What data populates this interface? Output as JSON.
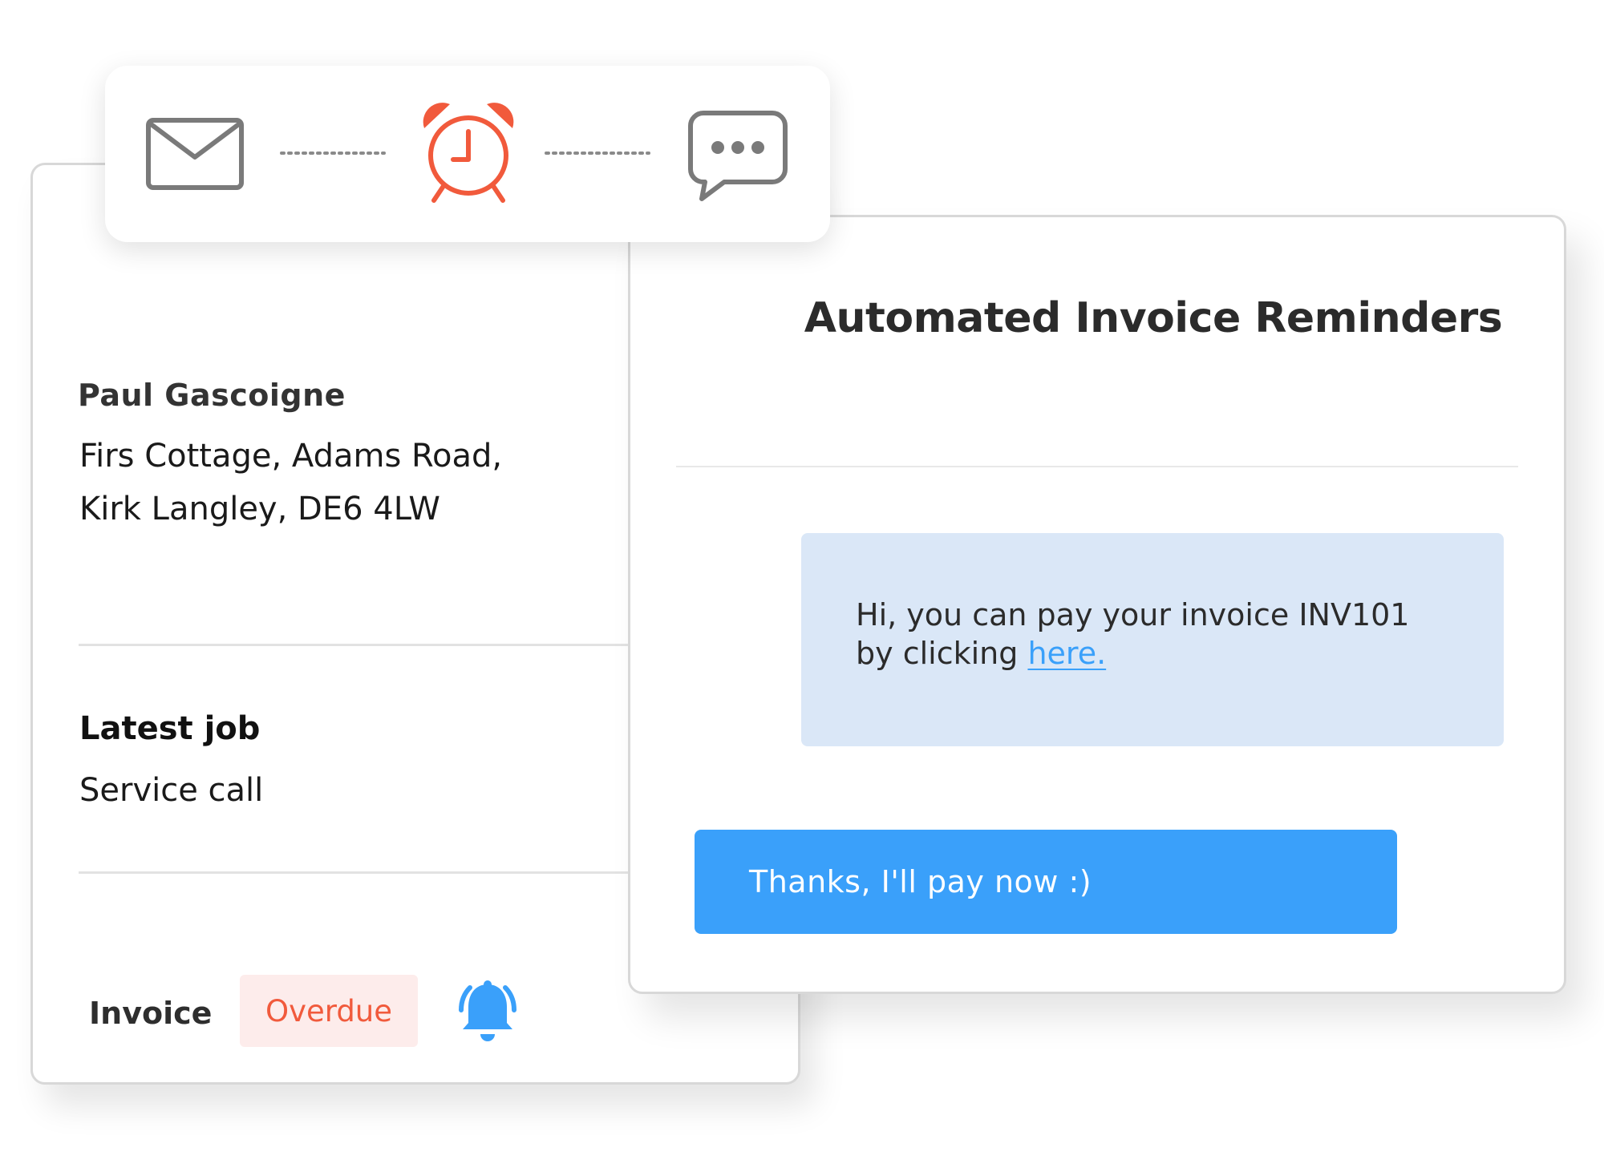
{
  "customer": {
    "name": "Paul Gascoigne",
    "address_line1": "Firs Cottage, Adams Road,",
    "address_line2": "Kirk Langley, DE6 4LW",
    "latest_job_heading": "Latest job",
    "latest_job_value": "Service call",
    "invoice_label": "Invoice",
    "invoice_status": "Overdue"
  },
  "channels": {
    "icons": [
      "mail-icon",
      "alarm-clock-icon",
      "chat-bubble-icon"
    ]
  },
  "reminder": {
    "title": "Automated Invoice Reminders",
    "message_line1": "Hi, you can pay your invoice INV101",
    "message_line2_prefix": "by clicking ",
    "message_link": "here.",
    "reply": "Thanks, I'll pay now :)"
  },
  "colors": {
    "accent_blue": "#3aa0fa",
    "alert_red": "#f15a3c",
    "badge_bg": "#fdeceb",
    "bubble_bg": "#dae7f7",
    "icon_gray": "#7a7a7a"
  }
}
